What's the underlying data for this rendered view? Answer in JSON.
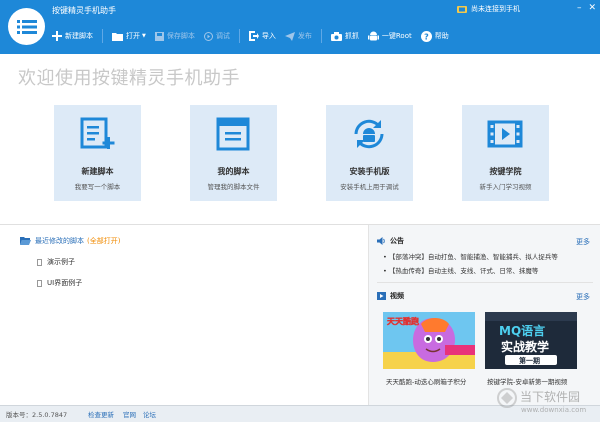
{
  "app": {
    "title": "按键精灵手机助手",
    "connection_status": "尚未连接到手机"
  },
  "toolbar": {
    "items": [
      {
        "id": "new",
        "label": "新建脚本"
      },
      {
        "id": "open",
        "label": "打开"
      },
      {
        "id": "save",
        "label": "保存脚本"
      },
      {
        "id": "debug",
        "label": "调试"
      },
      {
        "id": "import",
        "label": "导入"
      },
      {
        "id": "publish",
        "label": "发布"
      },
      {
        "id": "capture",
        "label": "抓抓"
      },
      {
        "id": "root",
        "label": "一键Root"
      },
      {
        "id": "help",
        "label": "帮助"
      }
    ]
  },
  "welcome": "欢迎使用按键精灵手机助手",
  "cards": [
    {
      "title": "新建脚本",
      "subtitle": "我要写一个脚本",
      "icon": "new-script-icon"
    },
    {
      "title": "我的脚本",
      "subtitle": "管理我的脚本文件",
      "icon": "my-scripts-icon"
    },
    {
      "title": "安装手机版",
      "subtitle": "安装手机上用于调试",
      "icon": "android-sync-icon"
    },
    {
      "title": "按键学院",
      "subtitle": "新手入门学习视频",
      "icon": "video-film-icon"
    }
  ],
  "recent": {
    "title": "最近修改的脚本",
    "open_all": "(全部打开)",
    "files": [
      "演示例子",
      "UI界面例子"
    ]
  },
  "announce": {
    "title": "公告",
    "more": "更多",
    "items": [
      "【部落冲突】自动打鱼、智能捕渔、智能捕兵、拟人捉兵等",
      "【热血传奇】自动主线、支线、讦式、日常、抹魔等"
    ]
  },
  "videos": {
    "title": "视频",
    "more": "更多",
    "items": [
      {
        "caption": "天天酷跑-动迭心刷箱子积分",
        "thumb_text": "天天酷跑"
      },
      {
        "caption": "按键学院-安卓新第一期视频",
        "thumb_text": "MQ语言",
        "thumb_sub": "实战教学",
        "thumb_tag": "第一期"
      }
    ]
  },
  "status": {
    "version": "版本号：2.5.0.7847",
    "links": [
      "检查更新",
      "官网",
      "论坛"
    ]
  },
  "watermark": {
    "text": "当下软件园",
    "url": "www.downxia.com"
  },
  "colors": {
    "brand_blue": "#1e88d8",
    "link_blue": "#2a6fb8",
    "accent_orange": "#f08a00"
  }
}
